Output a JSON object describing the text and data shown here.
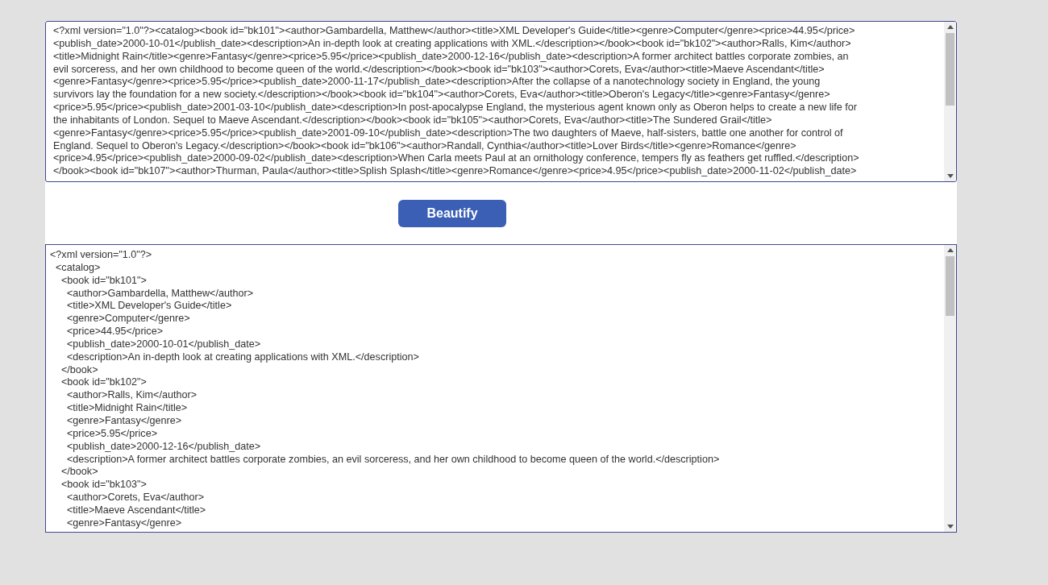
{
  "input_box": {
    "lines": [
      "<?xml version=\"1.0\"?><catalog><book id=\"bk101\"><author>Gambardella, Matthew</author><title>XML Developer's Guide</title><genre>Computer</genre><price>44.95</price>",
      "<publish_date>2000-10-01</publish_date><description>An in-depth look at creating applications with XML.</description></book><book id=\"bk102\"><author>Ralls, Kim</author>",
      "<title>Midnight Rain</title><genre>Fantasy</genre><price>5.95</price><publish_date>2000-12-16</publish_date><description>A former architect battles corporate zombies, an",
      "evil sorceress, and her own childhood to become queen of the world.</description></book><book id=\"bk103\"><author>Corets, Eva</author><title>Maeve Ascendant</title>",
      "<genre>Fantasy</genre><price>5.95</price><publish_date>2000-11-17</publish_date><description>After the collapse of a nanotechnology society in England, the young",
      "survivors lay the foundation for a new society.</description></book><book id=\"bk104\"><author>Corets, Eva</author><title>Oberon's Legacy</title><genre>Fantasy</genre>",
      "<price>5.95</price><publish_date>2001-03-10</publish_date><description>In post-apocalypse England, the mysterious agent known only as Oberon helps to create a new life for",
      "the inhabitants of London. Sequel to Maeve Ascendant.</description></book><book id=\"bk105\"><author>Corets, Eva</author><title>The Sundered Grail</title>",
      "<genre>Fantasy</genre><price>5.95</price><publish_date>2001-09-10</publish_date><description>The two daughters of Maeve, half-sisters, battle one another for control of",
      "England. Sequel to Oberon's Legacy.</description></book><book id=\"bk106\"><author>Randall, Cynthia</author><title>Lover Birds</title><genre>Romance</genre>",
      "<price>4.95</price><publish_date>2000-09-02</publish_date><description>When Carla meets Paul at an ornithology conference, tempers fly as feathers get ruffled.</description>",
      "</book><book id=\"bk107\"><author>Thurman, Paula</author><title>Splish Splash</title><genre>Romance</genre><price>4.95</price><publish_date>2000-11-02</publish_date>"
    ]
  },
  "beautify_button": "Beautify",
  "output_box": {
    "lines": [
      {
        "text": "<?xml version=\"1.0\"?>",
        "children": [
          {
            "text": "<catalog>",
            "children": [
              {
                "text": "<book id=\"bk101\">",
                "children": [
                  {
                    "text": "<author>Gambardella, Matthew</author>"
                  },
                  {
                    "text": "<title>XML Developer's Guide</title>"
                  },
                  {
                    "text": "<genre>Computer</genre>"
                  },
                  {
                    "text": "<price>44.95</price>"
                  },
                  {
                    "text": "<publish_date>2000-10-01</publish_date>"
                  },
                  {
                    "text": "<description>An in-depth look at creating applications with XML.</description>"
                  }
                ]
              },
              {
                "text": "</book>"
              },
              {
                "text": "<book id=\"bk102\">",
                "children": [
                  {
                    "text": "<author>Ralls, Kim</author>"
                  },
                  {
                    "text": "<title>Midnight Rain</title>"
                  },
                  {
                    "text": "<genre>Fantasy</genre>"
                  },
                  {
                    "text": "<price>5.95</price>"
                  },
                  {
                    "text": "<publish_date>2000-12-16</publish_date>"
                  },
                  {
                    "text": "<description>A former architect battles corporate zombies, an evil sorceress, and her own childhood to become queen of the world.</description>"
                  }
                ]
              },
              {
                "text": "</book>"
              },
              {
                "text": "<book id=\"bk103\">",
                "children": [
                  {
                    "text": "<author>Corets, Eva</author>"
                  },
                  {
                    "text": "<title>Maeve Ascendant</title>"
                  },
                  {
                    "text": "<genre>Fantasy</genre>"
                  }
                ]
              }
            ]
          }
        ]
      }
    ]
  }
}
